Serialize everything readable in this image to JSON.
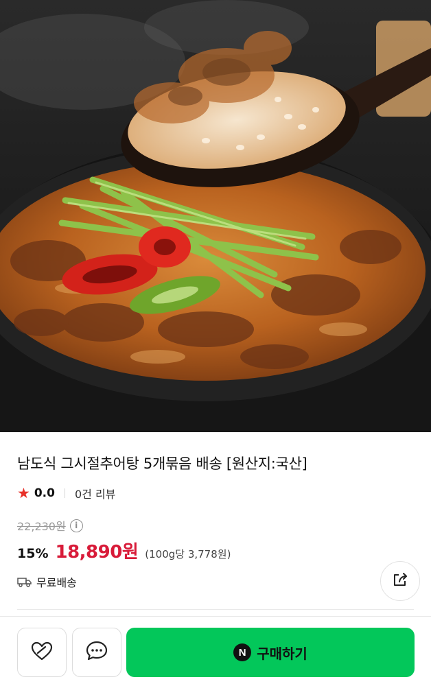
{
  "hero": {
    "image_description": "Stoneware pot of loach soup topped with chives and red/green peppers, with a wooden spoon lifting rice and soup"
  },
  "product": {
    "title": "남도식 그시절추어탕 5개묶음 배송 [원산지:국산]",
    "rating_value": "0.0",
    "review_count": "0건 리뷰",
    "original_price": "22,230원",
    "discount": "15%",
    "sale_price": "18,890원",
    "unit_price": "(100g당 3,778원)",
    "shipping": "무료배송"
  },
  "icons": {
    "star": "star-icon",
    "info": "info-icon",
    "truck": "truck-icon",
    "share": "share-icon",
    "like": "heart-icon",
    "chat": "chat-icon",
    "naver": "naver-n-icon"
  },
  "bottom_bar": {
    "buy_label": "구매하기",
    "naver_badge": "N"
  },
  "colors": {
    "accent_green": "#03c75a",
    "sale_red": "#d81b39",
    "star_red": "#e8322b"
  }
}
